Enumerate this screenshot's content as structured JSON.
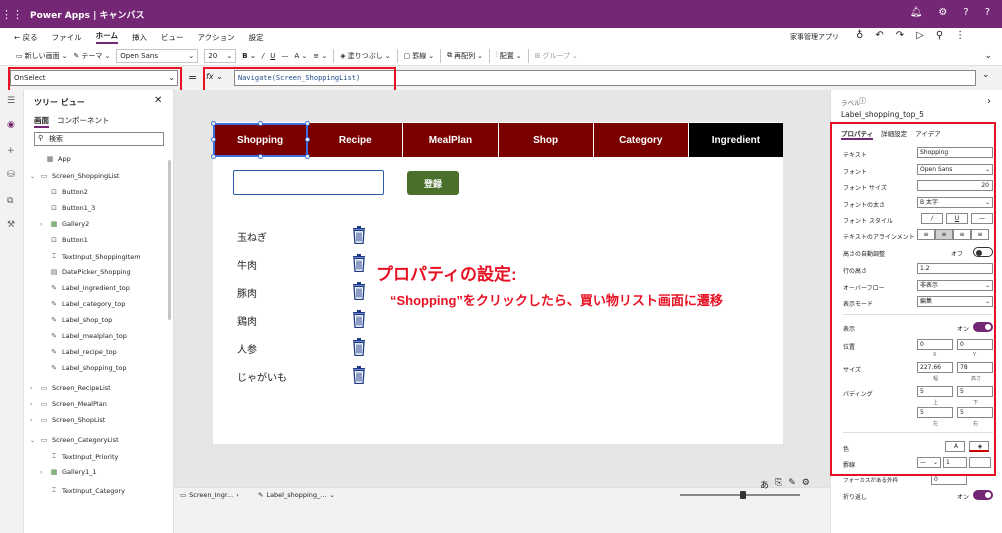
{
  "titlebar": {
    "title": "Power Apps | キャンバス"
  },
  "menu": {
    "back": "← 戻る",
    "file": "ファイル",
    "home": "ホーム",
    "insert": "挿入",
    "view": "ビュー",
    "action": "アクション",
    "settings": "設定",
    "app_name": "家事管理アプリ"
  },
  "ribbon": {
    "new_screen": "新しい画面",
    "theme": "テーマ",
    "font": "Open Sans",
    "size": "20",
    "fill": "塗りつぶし",
    "border": "罫線",
    "reorder": "再配列",
    "align": "配置",
    "group": "グループ"
  },
  "formula": {
    "property": "OnSelect",
    "fx": "fx",
    "equals": "=",
    "expression": "Navigate(Screen_ShoppingList)"
  },
  "tree": {
    "title": "ツリー ビュー",
    "tab_screens": "画面",
    "tab_components": "コンポーネント",
    "search_placeholder": "検索",
    "items": [
      {
        "label": "App"
      },
      {
        "label": "Screen_ShoppingList"
      },
      {
        "label": "Button2"
      },
      {
        "label": "Button1_3"
      },
      {
        "label": "Gallery2"
      },
      {
        "label": "Button1"
      },
      {
        "label": "TextInput_ShoppingItem"
      },
      {
        "label": "DatePicker_Shopping"
      },
      {
        "label": "Label_ingredient_top"
      },
      {
        "label": "Label_category_top"
      },
      {
        "label": "Label_shop_top"
      },
      {
        "label": "Label_mealplan_top"
      },
      {
        "label": "Label_recipe_top"
      },
      {
        "label": "Label_shopping_top"
      },
      {
        "label": "Screen_RecipeList"
      },
      {
        "label": "Screen_MealPlan"
      },
      {
        "label": "Screen_ShopList"
      },
      {
        "label": "Screen_CategoryList"
      },
      {
        "label": "TextInput_Priority"
      },
      {
        "label": "Gallery1_1"
      },
      {
        "label": "TextInput_Category"
      }
    ]
  },
  "canvas": {
    "nav": [
      "Shopping",
      "Recipe",
      "MealPlan",
      "Shop",
      "Category",
      "Ingredient"
    ],
    "register": "登録",
    "items": [
      "玉ねぎ",
      "牛肉",
      "豚肉",
      "鶏肉",
      "人参",
      "じゃがいも"
    ]
  },
  "annotation": {
    "title": "プロパティの設定:",
    "body": "“Shopping”をクリックしたら、買い物リスト画面に遷移"
  },
  "status": {
    "screen_crumb": "Screen_Ingr...",
    "label_crumb": "Label_shopping_..."
  },
  "props": {
    "type": "ラベル",
    "name": "Label_shopping_top_5",
    "tabs": [
      "プロパティ",
      "詳細設定",
      "アイデア"
    ],
    "text_label": "テキスト",
    "text_value": "Shopping",
    "font_label": "フォント",
    "font_value": "Open Sans",
    "fontsize_label": "フォント サイズ",
    "fontsize_value": "20",
    "weight_label": "フォントの太さ",
    "weight_value": "B 太字",
    "style_label": "フォント スタイル",
    "align_label": "テキストのアラインメント",
    "autoheight_label": "高さの自動調整",
    "autoheight_state": "オフ",
    "lineheight_label": "行の高さ",
    "lineheight_value": "1.2",
    "overflow_label": "オーバーフロー",
    "overflow_value": "非表示",
    "mode_label": "表示モード",
    "mode_value": "編集",
    "visible_label": "表示",
    "visible_state": "オン",
    "position_label": "位置",
    "pos_x": "0",
    "pos_y": "0",
    "x": "X",
    "y": "Y",
    "size_label": "サイズ",
    "width": "227.66",
    "height": "78",
    "width_l": "幅",
    "height_l": "高さ",
    "padding_label": "パディング",
    "pad_top": "5",
    "pad_bottom": "5",
    "pad_left": "5",
    "pad_right": "5",
    "top_l": "上",
    "bottom_l": "下",
    "left_l": "左",
    "right_l": "右",
    "color_label": "色",
    "color_a": "A",
    "border_label": "罫線",
    "border_width": "1",
    "focus_label": "フォーカスがある外枠",
    "focus_value": "0",
    "wrap_label": "折り返し",
    "wrap_state": "オン"
  }
}
